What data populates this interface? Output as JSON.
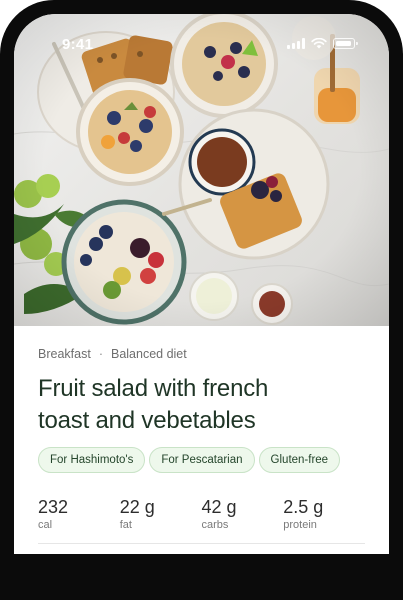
{
  "status_bar": {
    "time": "9:41"
  },
  "recipe": {
    "categories": [
      "Breakfast",
      "Balanced diet"
    ],
    "separator": "·",
    "title_line1": "Fruit salad with french",
    "title_line2": "toast and vebetables",
    "tags": [
      "For Hashimoto's",
      "For Pescatarian",
      "Gluten-free"
    ]
  },
  "nutrition": [
    {
      "value": "232",
      "unit": "cal"
    },
    {
      "value": "22 g",
      "unit": "fat"
    },
    {
      "value": "42 g",
      "unit": "carbs"
    },
    {
      "value": "2.5 g",
      "unit": "protein"
    }
  ],
  "colors": {
    "title": "#1f3526",
    "tag_background": "#eef8ec",
    "tag_border": "#c9e3c7"
  },
  "icons": [
    "cellular-signal-icon",
    "wifi-icon",
    "battery-icon"
  ]
}
